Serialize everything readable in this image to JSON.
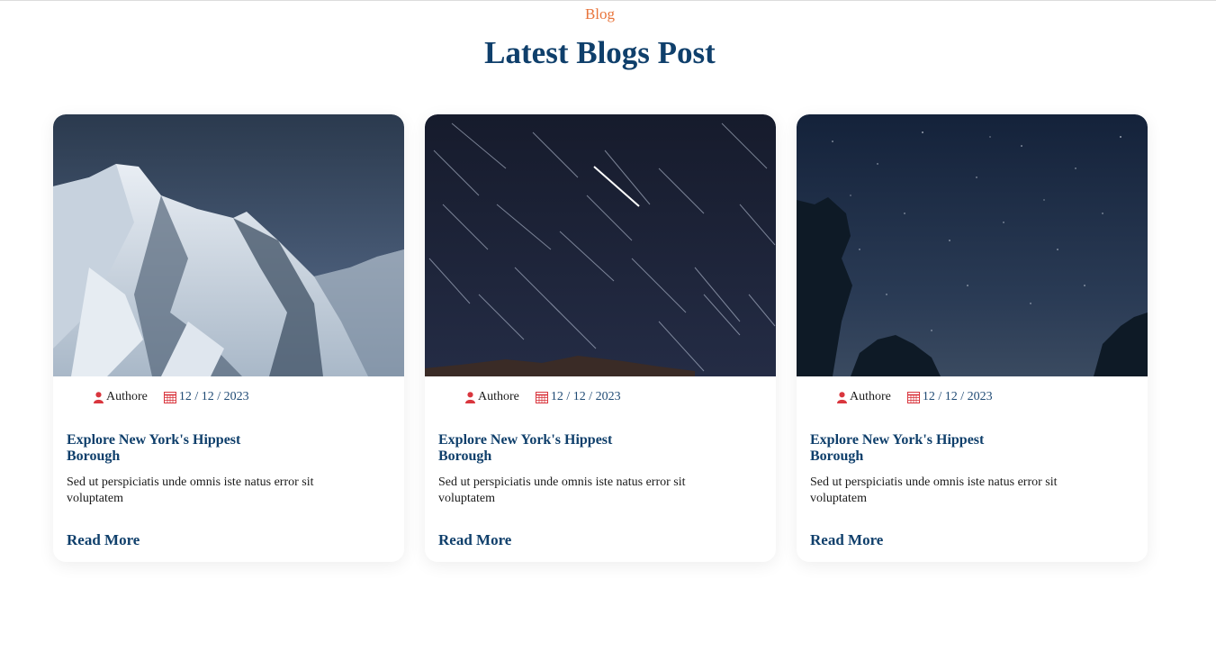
{
  "section": {
    "eyebrow": "Blog",
    "heading": "Latest Blogs Post"
  },
  "colors": {
    "accent": "#e8743b",
    "primary": "#0f3f6b",
    "icon": "#d9363e"
  },
  "cards": [
    {
      "image": "snowy-mountain-image",
      "author": "Authore",
      "date": "12 / 12 / 2023",
      "title": "Explore New York's Hippest Borough",
      "description": "Sed ut perspiciatis unde omnis iste natus error sit voluptatem",
      "read_more": "Read More"
    },
    {
      "image": "star-trails-image",
      "author": "Authore",
      "date": "12 / 12 / 2023",
      "title": "Explore New York's Hippest Borough",
      "description": "Sed ut perspiciatis unde omnis iste natus error sit voluptatem",
      "read_more": "Read More"
    },
    {
      "image": "starry-night-trees-image",
      "author": "Authore",
      "date": "12 / 12 / 2023",
      "title": "Explore New York's Hippest Borough",
      "description": "Sed ut perspiciatis unde omnis iste natus error sit voluptatem",
      "read_more": "Read More"
    }
  ]
}
